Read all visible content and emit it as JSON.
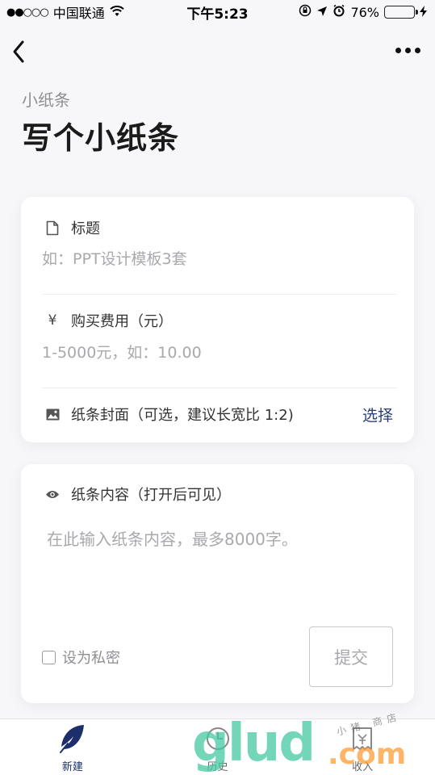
{
  "status_bar": {
    "signal": "●●○○○",
    "carrier": "中国联通",
    "time": "下午5:23",
    "battery_percent": "76%",
    "battery_level": 0.76
  },
  "page": {
    "subtitle": "小纸条",
    "title": "写个小纸条"
  },
  "form": {
    "title_label": "标题",
    "title_placeholder": "如：PPT设计模板3套",
    "fee_label": "购买费用（元）",
    "fee_placeholder": "1-5000元，如：10.00",
    "cover_label": "纸条封面（可选，建议长宽比 1:2)",
    "cover_action": "选择",
    "content_label": "纸条内容（打开后可见）",
    "content_placeholder": "在此输入纸条内容，最多8000字。",
    "private_label": "设为私密",
    "submit_label": "提交"
  },
  "tabs": [
    {
      "label": "新建",
      "icon": "feather-icon",
      "active": true
    },
    {
      "label": "历史",
      "icon": "history-icon",
      "active": false
    },
    {
      "label": "收入",
      "icon": "income-icon",
      "active": false
    }
  ],
  "watermark": {
    "brand": "glud",
    "domain": ".com",
    "shop": "小猪 商店"
  },
  "colors": {
    "accent": "#2a3d7c",
    "tab_active": "#1c2f6b",
    "battery": "#f5c518"
  }
}
